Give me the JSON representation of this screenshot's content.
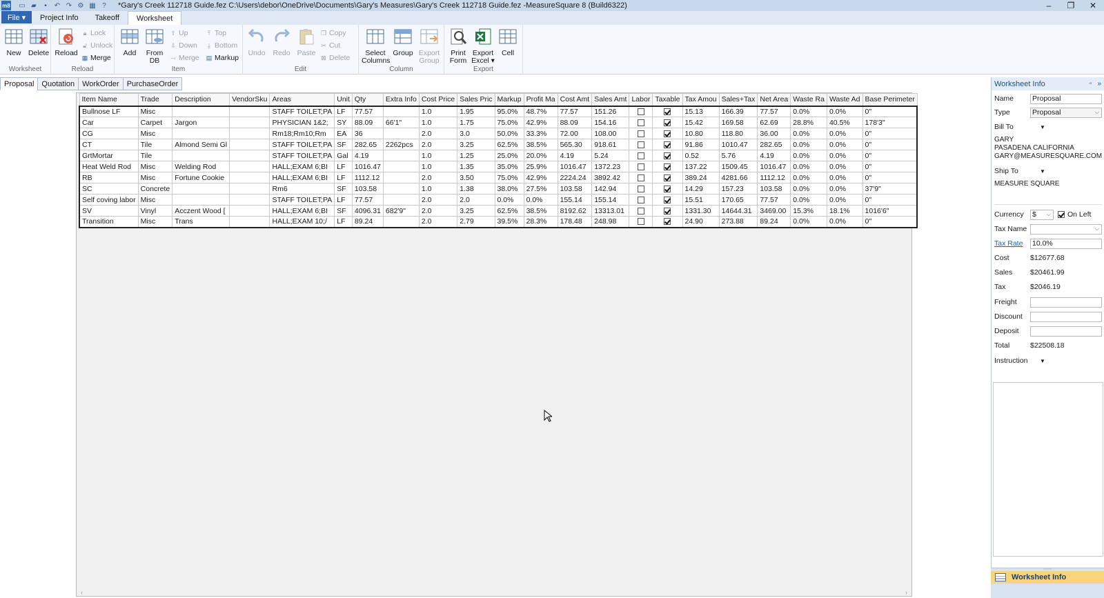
{
  "titlebar": {
    "app_icon": "m8",
    "title": "*Gary's Creek 112718 Guide.fez C:\\Users\\debor\\OneDrive\\Documents\\Gary's Measures\\Gary's Creek 112718 Guide.fez -MeasureSquare 8 (Build6322)",
    "minimize": "–",
    "restore": "❐",
    "close": "✕"
  },
  "ribbon_tabs": {
    "file": "File ▾",
    "project_info": "Project Info",
    "takeoff": "Takeoff",
    "worksheet": "Worksheet"
  },
  "ribbon": {
    "worksheet_group": {
      "label": "Worksheet",
      "new": "New",
      "delete": "Delete"
    },
    "reload_group": {
      "label": "Reload",
      "reload": "Reload",
      "lock": "Lock",
      "unlock": "Unlock",
      "merge": "Merge"
    },
    "item_group": {
      "label": "Item",
      "add": "Add",
      "from_db": "From DB",
      "up": "Up",
      "down": "Down",
      "merge": "Merge",
      "top": "Top",
      "bottom": "Bottom",
      "markup": "Markup"
    },
    "edit_group": {
      "label": "Edit",
      "undo": "Undo",
      "redo": "Redo",
      "paste": "Paste",
      "copy": "Copy",
      "cut": "Cut",
      "delete": "Delete"
    },
    "column_group": {
      "label": "Column",
      "select_columns": "Select Columns",
      "group": "Group",
      "export_group": "Export Group"
    },
    "export_group_r": {
      "label": "Export",
      "print_form": "Print Form",
      "export_excel": "Export Excel ▾",
      "cell": "Cell"
    }
  },
  "worksheet_tabs": [
    "Proposal",
    "Quotation",
    "WorkOrder",
    "PurchaseOrder"
  ],
  "grid": {
    "columns": [
      "Item Name",
      "Trade",
      "Description",
      "VendorSku",
      "Areas",
      "Unit",
      "Qty",
      "Extra Info",
      "Cost Price",
      "Sales Pric",
      "Markup",
      "Profit Ma",
      "Cost Amt",
      "Sales Amt",
      "Labor",
      "Taxable",
      "Tax Amou",
      "Sales+Tax",
      "Net Area",
      "Waste Ra",
      "Waste Ad",
      "Base Perimeter"
    ],
    "rows": [
      [
        "Bullnose LF",
        "Misc",
        "",
        "",
        "STAFF TOILET;PA",
        "LF",
        "77.57",
        "",
        "1.0",
        "1.95",
        "95.0%",
        "48.7%",
        "77.57",
        "151.26",
        false,
        true,
        "15.13",
        "166.39",
        "77.57",
        "0.0%",
        "0.0%",
        "0\""
      ],
      [
        "Car",
        "Carpet",
        "Jargon",
        "",
        "PHYSICIAN 1&2;",
        "SY",
        "88.09",
        "66'1\"",
        "1.0",
        "1.75",
        "75.0%",
        "42.9%",
        "88.09",
        "154.16",
        false,
        true,
        "15.42",
        "169.58",
        "62.69",
        "28.8%",
        "40.5%",
        "178'3\""
      ],
      [
        "CG",
        "Misc",
        "",
        "",
        "Rm18;Rm10;Rm",
        "EA",
        "36",
        "",
        "2.0",
        "3.0",
        "50.0%",
        "33.3%",
        "72.00",
        "108.00",
        false,
        true,
        "10.80",
        "118.80",
        "36.00",
        "0.0%",
        "0.0%",
        "0\""
      ],
      [
        "CT",
        "Tile",
        "Almond Semi Gl",
        "",
        "STAFF TOILET;PA",
        "SF",
        "282.65",
        "2262pcs",
        "2.0",
        "3.25",
        "62.5%",
        "38.5%",
        "565.30",
        "918.61",
        false,
        true,
        "91.86",
        "1010.47",
        "282.65",
        "0.0%",
        "0.0%",
        "0\""
      ],
      [
        "GrtMortar",
        "Tile",
        "",
        "",
        "STAFF TOILET;PA",
        "Gal",
        "4.19",
        "",
        "1.0",
        "1.25",
        "25.0%",
        "20.0%",
        "4.19",
        "5.24",
        false,
        true,
        "0.52",
        "5.76",
        "4.19",
        "0.0%",
        "0.0%",
        "0\""
      ],
      [
        "Heat Weld Rod",
        "Misc",
        "Welding Rod",
        "",
        "HALL;EXAM 6;BI",
        "LF",
        "1016.47",
        "",
        "1.0",
        "1.35",
        "35.0%",
        "25.9%",
        "1016.47",
        "1372.23",
        false,
        true,
        "137.22",
        "1509.45",
        "1016.47",
        "0.0%",
        "0.0%",
        "0\""
      ],
      [
        "RB",
        "Misc",
        "Fortune Cookie",
        "",
        "HALL;EXAM 6;BI",
        "LF",
        "1112.12",
        "",
        "2.0",
        "3.50",
        "75.0%",
        "42.9%",
        "2224.24",
        "3892.42",
        false,
        true,
        "389.24",
        "4281.66",
        "1112.12",
        "0.0%",
        "0.0%",
        "0\""
      ],
      [
        "SC",
        "Concrete",
        "",
        "",
        "Rm6",
        "SF",
        "103.58",
        "",
        "1.0",
        "1.38",
        "38.0%",
        "27.5%",
        "103.58",
        "142.94",
        false,
        true,
        "14.29",
        "157.23",
        "103.58",
        "0.0%",
        "0.0%",
        "37'9\""
      ],
      [
        "Self coving labor",
        "Misc",
        "",
        "",
        "STAFF TOILET;PA",
        "LF",
        "77.57",
        "",
        "2.0",
        "2.0",
        "0.0%",
        "0.0%",
        "155.14",
        "155.14",
        false,
        true,
        "15.51",
        "170.65",
        "77.57",
        "0.0%",
        "0.0%",
        "0\""
      ],
      [
        "SV",
        "Vinyl",
        "Acczent Wood  [",
        "",
        "HALL;EXAM 6;BI",
        "SF",
        "4096.31",
        "682'9\"",
        "2.0",
        "3.25",
        "62.5%",
        "38.5%",
        "8192.62",
        "13313.01",
        false,
        true,
        "1331.30",
        "14644.31",
        "3469.00",
        "15.3%",
        "18.1%",
        "1016'6\""
      ],
      [
        "Transition",
        "Misc",
        "Trans",
        "",
        "HALL;EXAM 10;/",
        "LF",
        "89.24",
        "",
        "2.0",
        "2.79",
        "39.5%",
        "28.3%",
        "178.48",
        "248.98",
        false,
        true,
        "24.90",
        "273.88",
        "89.24",
        "0.0%",
        "0.0%",
        "0\""
      ]
    ]
  },
  "info_panel": {
    "title": "Worksheet Info",
    "name_label": "Name",
    "name_value": "Proposal",
    "type_label": "Type",
    "type_value": "Proposal",
    "bill_to_label": "Bill To",
    "bill_to_lines": [
      "GARY",
      "PASADENA CALIFORNIA",
      "GARY@MEASURESQUARE.COM"
    ],
    "ship_to_label": "Ship To",
    "ship_to_text": "MEASURE SQUARE",
    "currency_label": "Currency",
    "currency_value": "$",
    "on_left_label": "On Left",
    "on_left_checked": true,
    "tax_name_label": "Tax Name",
    "tax_name_value": "",
    "tax_rate_label": "Tax Rate",
    "tax_rate_value": "10.0%",
    "cost_label": "Cost",
    "cost_value": "$12677.68",
    "sales_label": "Sales",
    "sales_value": "$20461.99",
    "tax_label": "Tax",
    "tax_value": "$2046.19",
    "freight_label": "Freight",
    "freight_value": "",
    "discount_label": "Discount",
    "discount_value": "",
    "deposit_label": "Deposit",
    "deposit_value": "",
    "total_label": "Total",
    "total_value": "$22508.18",
    "instruction_label": "Instruction",
    "footer_button": "Worksheet Info"
  },
  "colors": {
    "accent": "#2f67b0",
    "ribbon_bg": "#f5f8fc",
    "footer_highlight": "#f8d47a"
  }
}
